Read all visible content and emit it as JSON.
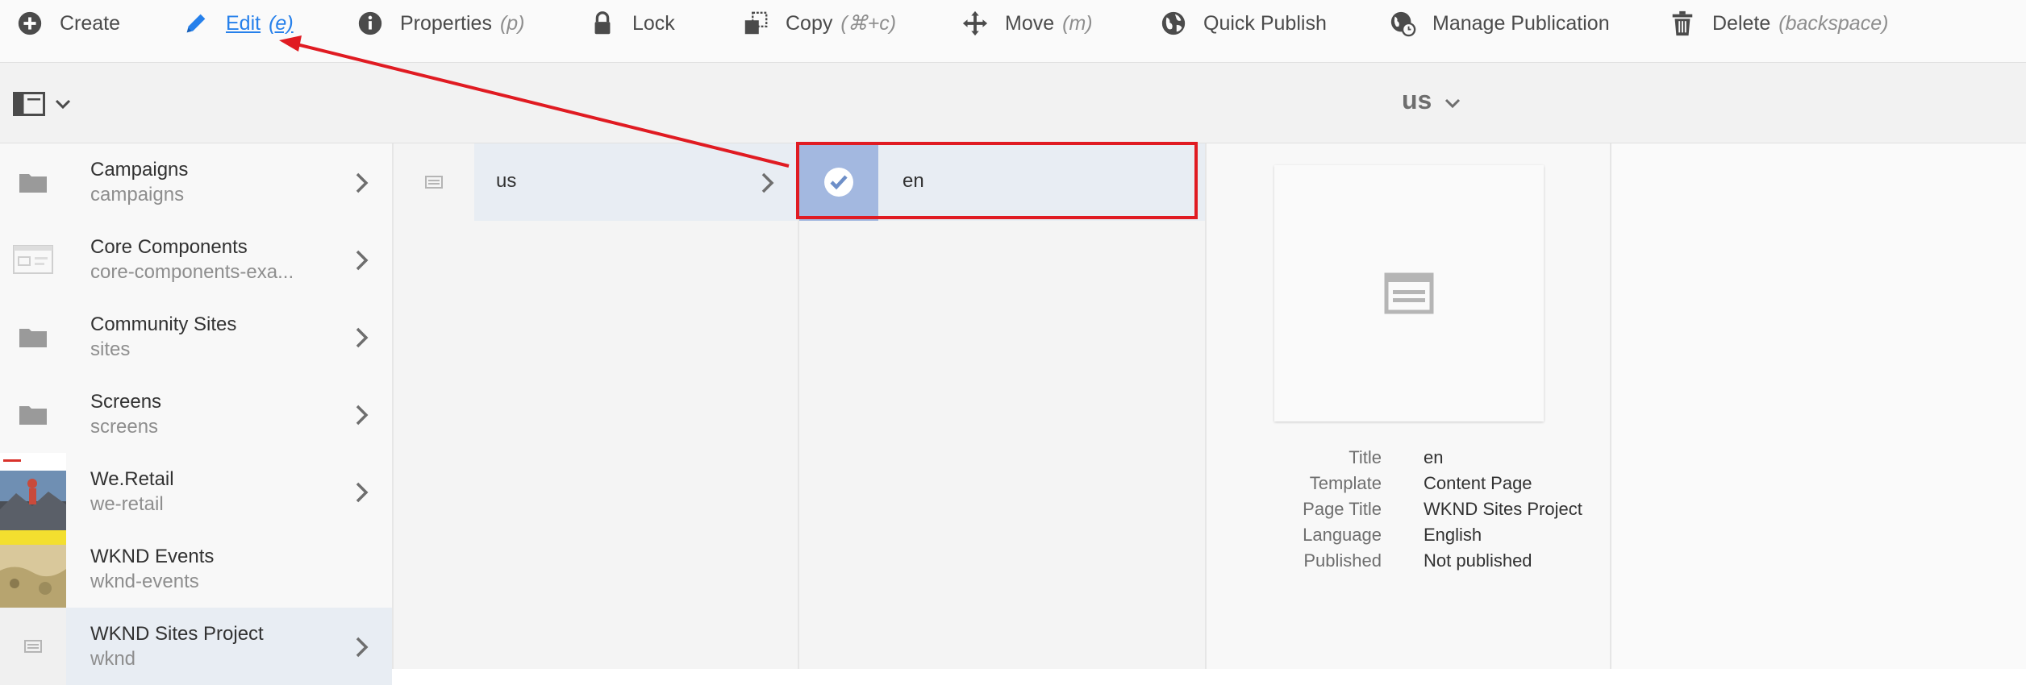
{
  "actionbar": {
    "create": {
      "label": "Create",
      "icon": "add-circle-icon"
    },
    "edit": {
      "label": "Edit",
      "shortcut": "(e)",
      "icon": "pencil-icon"
    },
    "properties": {
      "label": "Properties",
      "shortcut": "(p)",
      "icon": "info-icon"
    },
    "lock": {
      "label": "Lock",
      "icon": "lock-icon"
    },
    "copy": {
      "label": "Copy",
      "shortcut": "(⌘+c)",
      "icon": "copy-icon"
    },
    "move": {
      "label": "Move",
      "shortcut": "(m)",
      "icon": "move-icon"
    },
    "quick_publish": {
      "label": "Quick Publish",
      "icon": "globe-icon"
    },
    "manage_publication": {
      "label": "Manage Publication",
      "icon": "globe-clock-icon"
    },
    "delete": {
      "label": "Delete",
      "shortcut": "(backspace)",
      "icon": "trash-icon"
    }
  },
  "header": {
    "title": "us"
  },
  "columns": {
    "sites": [
      {
        "title": "Campaigns",
        "subtitle": "campaigns",
        "thumb": "folder-icon",
        "has_children": true
      },
      {
        "title": "Core Components",
        "subtitle": "core-components-exa...",
        "thumb": "page-template-icon",
        "has_children": true
      },
      {
        "title": "Community Sites",
        "subtitle": "sites",
        "thumb": "folder-icon",
        "has_children": true
      },
      {
        "title": "Screens",
        "subtitle": "screens",
        "thumb": "folder-icon",
        "has_children": true
      },
      {
        "title": "We.Retail",
        "subtitle": "we-retail",
        "thumb": "photo-thumbnail",
        "has_children": true
      },
      {
        "title": "WKND Events",
        "subtitle": "wknd-events",
        "thumb": "photo-thumbnail",
        "has_children": false
      },
      {
        "title": "WKND Sites Project",
        "subtitle": "wknd",
        "thumb": "page-icon",
        "has_children": true,
        "selected": true
      }
    ],
    "country": {
      "label": "us"
    },
    "language": {
      "label": "en",
      "selected": true
    }
  },
  "preview": {
    "meta": [
      {
        "key": "Title",
        "value": "en"
      },
      {
        "key": "Template",
        "value": "Content Page"
      },
      {
        "key": "Page Title",
        "value": "WKND Sites Project"
      },
      {
        "key": "Language",
        "value": "English"
      },
      {
        "key": "Published",
        "value": "Not published"
      }
    ]
  },
  "colors": {
    "accent": "#2680eb",
    "annotation": "#e01b22",
    "selected_row": "#e8edf3",
    "check_bg": "#a3b8e0"
  }
}
